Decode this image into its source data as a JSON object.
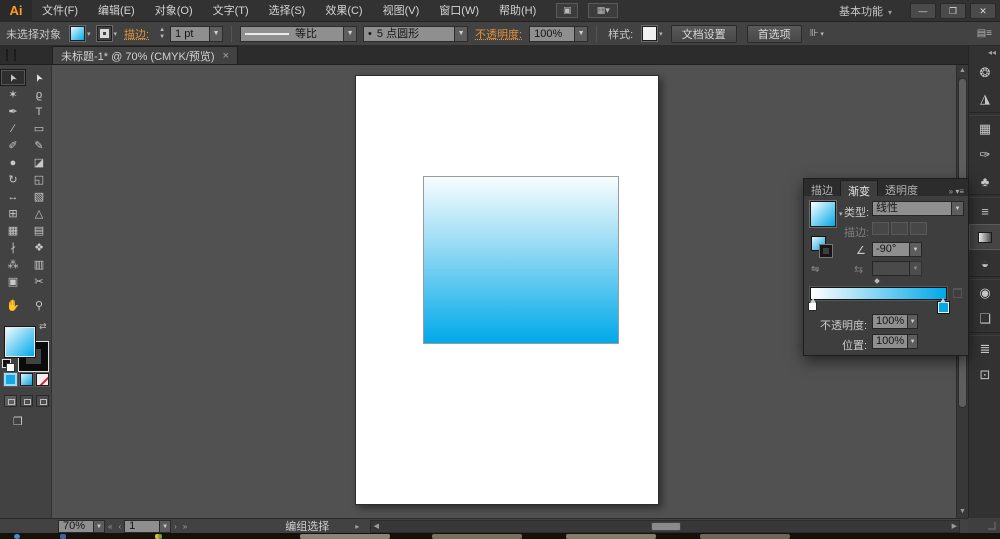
{
  "window": {
    "logo": "Ai",
    "workspace_switcher": "基本功能",
    "caret": "▾",
    "minimize": "—",
    "restore": "❐",
    "close": "✕"
  },
  "menu": {
    "items": [
      {
        "name": "menu-file",
        "label": "文件(F)"
      },
      {
        "name": "menu-edit",
        "label": "编辑(E)"
      },
      {
        "name": "menu-object",
        "label": "对象(O)"
      },
      {
        "name": "menu-type",
        "label": "文字(T)"
      },
      {
        "name": "menu-select",
        "label": "选择(S)"
      },
      {
        "name": "menu-effect",
        "label": "效果(C)"
      },
      {
        "name": "menu-view",
        "label": "视图(V)"
      },
      {
        "name": "menu-window",
        "label": "窗口(W)"
      },
      {
        "name": "menu-help",
        "label": "帮助(H)"
      }
    ]
  },
  "options": {
    "selection_status": "未选择对象",
    "stroke_label": "描边:",
    "stroke_width": "1 pt",
    "profile_label": "等比",
    "brush_bullet": "•",
    "brush_label": "5 点圆形",
    "opacity_label": "不透明度:",
    "opacity_value": "100%",
    "style_label": "样式:",
    "doc_setup_button": "文档设置",
    "preferences_button": "首选项"
  },
  "document_tab": {
    "title": "未标题-1* @ 70% (CMYK/预览)",
    "close": "×"
  },
  "tools": {
    "items": [
      {
        "name": "selection-tool",
        "glyph": "➤",
        "rot": true,
        "selected": true
      },
      {
        "name": "direct-selection-tool",
        "glyph": "➤",
        "rot": true,
        "dim": true
      },
      {
        "name": "magic-wand-tool",
        "glyph": "✶"
      },
      {
        "name": "lasso-tool",
        "glyph": "ϱ"
      },
      {
        "name": "pen-tool",
        "glyph": "✒"
      },
      {
        "name": "type-tool",
        "glyph": "T"
      },
      {
        "name": "line-segment-tool",
        "glyph": "∕"
      },
      {
        "name": "rectangle-tool",
        "glyph": "▭"
      },
      {
        "name": "paintbrush-tool",
        "glyph": "✐"
      },
      {
        "name": "pencil-tool",
        "glyph": "✎"
      },
      {
        "name": "blob-brush-tool",
        "glyph": "●"
      },
      {
        "name": "eraser-tool",
        "glyph": "◪"
      },
      {
        "name": "rotate-tool",
        "glyph": "↻"
      },
      {
        "name": "scale-tool",
        "glyph": "◱"
      },
      {
        "name": "width-tool",
        "glyph": "↔"
      },
      {
        "name": "free-transform-tool",
        "glyph": "▧"
      },
      {
        "name": "shape-builder-tool",
        "glyph": "⊞"
      },
      {
        "name": "perspective-grid-tool",
        "glyph": "△"
      },
      {
        "name": "mesh-tool",
        "glyph": "▦"
      },
      {
        "name": "gradient-tool",
        "glyph": "▤"
      },
      {
        "name": "eyedropper-tool",
        "glyph": "∤"
      },
      {
        "name": "blend-tool",
        "glyph": "❖"
      },
      {
        "name": "symbol-sprayer-tool",
        "glyph": "⁂"
      },
      {
        "name": "column-graph-tool",
        "glyph": "▥"
      },
      {
        "name": "artboard-tool",
        "glyph": "▣"
      },
      {
        "name": "slice-tool",
        "glyph": "✂"
      }
    ],
    "extra": [
      {
        "name": "hand-tool",
        "glyph": "✋"
      },
      {
        "name": "zoom-tool",
        "glyph": "⚲"
      }
    ]
  },
  "dock": {
    "collapse": "◂◂",
    "items": [
      {
        "name": "color-panel-icon",
        "glyph": "❂"
      },
      {
        "name": "color-guide-panel-icon",
        "glyph": "◮"
      },
      {
        "type": "sep"
      },
      {
        "name": "swatches-panel-icon",
        "glyph": "▦"
      },
      {
        "name": "brushes-panel-icon",
        "glyph": "✑"
      },
      {
        "name": "symbols-panel-icon",
        "glyph": "♣"
      },
      {
        "type": "sep"
      },
      {
        "name": "stroke-panel-icon",
        "glyph": "≡"
      },
      {
        "name": "gradient-panel-icon",
        "box": true,
        "selected": true,
        "glyph": ""
      },
      {
        "name": "transparency-panel-icon",
        "glyph": "◒"
      },
      {
        "type": "sep"
      },
      {
        "name": "appearance-panel-icon",
        "glyph": "◉"
      },
      {
        "name": "graphic-styles-panel-icon",
        "glyph": "❏"
      },
      {
        "type": "sep"
      },
      {
        "name": "layers-panel-icon",
        "glyph": "≣"
      },
      {
        "name": "artboards-panel-icon",
        "glyph": "⊡"
      }
    ]
  },
  "gradient_panel": {
    "tabs": [
      {
        "name": "tab-stroke",
        "label": "描边"
      },
      {
        "name": "tab-gradient",
        "label": "渐变",
        "active": true
      },
      {
        "name": "tab-transparency",
        "label": "透明度"
      }
    ],
    "header_icons": "»  ▾≡",
    "type_label": "类型:",
    "type_value": "线性",
    "stroke_label": "描边:",
    "angle_glyph": "∠",
    "angle_value": "-90°",
    "aspect_glyph": "⇆",
    "opacity_label": "不透明度:",
    "opacity_value": "100%",
    "location_label": "位置:",
    "location_value": "100%",
    "gradient": {
      "type": "linear",
      "angle_deg": -90,
      "start_color": "#ffffff",
      "end_color": "#00a8e8",
      "midpoint": "50%",
      "selected_stop": "end (100%)"
    }
  },
  "status_bar": {
    "zoom_value": "70%",
    "nav_first": "«",
    "nav_prev": "‹",
    "artboard_value": "1",
    "nav_next": "›",
    "nav_last": "»",
    "tool_status": "编组选择",
    "flyout": "▸"
  },
  "canvas": {
    "gradient_rect": {
      "top_color": "#f8fdff",
      "bottom_color": "#00a9e9"
    }
  },
  "colors": {
    "accent_blue": "#00a9e9",
    "link_orange": "#e0923f"
  }
}
